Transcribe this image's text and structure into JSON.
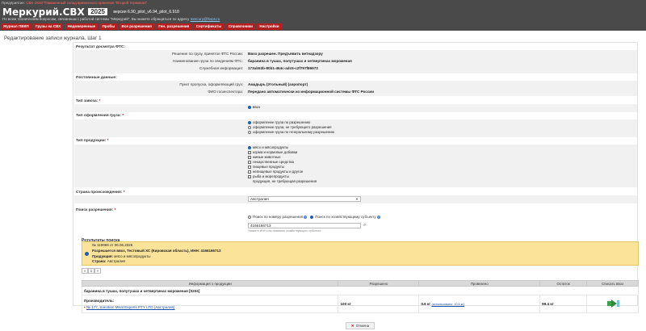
{
  "header": {
    "org_label": "Предприятие:",
    "org_name": "СВХ ООО\"Таможенный склад временного хранения \"Второй терминал\"",
    "app_name": "Меркурий.СВХ",
    "year": "2025",
    "version": "версия 6.90_pilot_v6.94_pilot_6.918",
    "help_text": "По всем техническим вопросам, связанным с работой системы \"Меркурий\", Вы можете обращаться по адресу",
    "help_email": "mercury@fsvps.ru"
  },
  "menu": [
    "Журнал ПВКП",
    "Грузы на СВХ",
    "Недоверенные",
    "Пробы",
    "Все разрешения",
    "Ген. разрешения",
    "Сертификаты",
    "Справочники",
    "Настройки"
  ],
  "page_title": "Редактирование записи журнала. Шаг 1",
  "fts_section": {
    "title": "Результат досмотра ФТС:",
    "rows": [
      {
        "label": "Решение по грузу, принятое ФТС России:",
        "value": "Ввоз разрешен. Предъявить ветнадзору"
      },
      {
        "label": "Наименование груза по сведениям ФТС:",
        "value": "баранина в тушах, полутушах и четвертинах мороженая"
      },
      {
        "label": "Служебная информация:",
        "value": "173ab53b-80b1-464c-adc5-c2f797f86973"
      }
    ]
  },
  "const_section": {
    "title": "Постоянные данные:",
    "rows": [
      {
        "label": "Пункт пропуска, оформляющий груз:",
        "value": "Амадырь (Угольный) (аэропорт)"
      },
      {
        "label": "ФИО госинспектора:",
        "value": "Передано автоматически из информационной системы ФТС России"
      }
    ]
  },
  "import_type": {
    "title": "Тип завоза:",
    "options": [
      "ввоз"
    ]
  },
  "clearance_type": {
    "title": "Тип оформления груза:",
    "options": [
      "оформление груза по разрешению",
      "оформление груза, не требующего разрешения",
      "оформление груза по генеральному разрешению"
    ]
  },
  "product_type": {
    "title": "Тип продукции:",
    "options": [
      "мясо и мясопродукты",
      "корма и кормовые добавки",
      "живые животные",
      "лекарственные средства",
      "пищевые продукты",
      "непищевые продукты и другое",
      "рыба и морепродукты",
      "продукция, не требующая разрешения"
    ]
  },
  "origin_country": {
    "title": "Страна происхождения:",
    "value": "Австралия"
  },
  "permit_search": {
    "title": "Поиск разрешения:",
    "by_number": "Поиск по номеру разрешения",
    "by_entity": "Поиск по хозяйствующему субъекту",
    "input_value": "4166166713",
    "hint": "Укажите ИНН или название хозяйствующего субъекта"
  },
  "results": {
    "title": "Результаты поиска",
    "card": {
      "number": "№ 119969 от 06.06.2025",
      "allowed": "Разрешается ввоз, Тестовый ХС (Кировская область), ИНН: 4166166713",
      "product_label": "Продукция:",
      "product_value": "мясо и мясопродукты",
      "country_label": "Страна:",
      "country_value": "Австралия"
    },
    "pages": [
      "«",
      "1",
      "»"
    ]
  },
  "product_table": {
    "headers": [
      "Информация о продукции",
      "Разрешено",
      "Провезено",
      "Остаток",
      "Списать ввоз"
    ],
    "product_title": "баранина в тушах, полутушах и четвертинах мороженая [0204]",
    "manufacturer_label": "Производитель:",
    "manufacturer": "№ 177, Sanotion Meat Exports PTY LTD (Австралия)",
    "allowed": "100 кг",
    "transported": "0.6 кг",
    "transported_link": "(использовано: 10.6 кг)",
    "remainder": "99.4 кг"
  },
  "cancel_label": "Отмена"
}
